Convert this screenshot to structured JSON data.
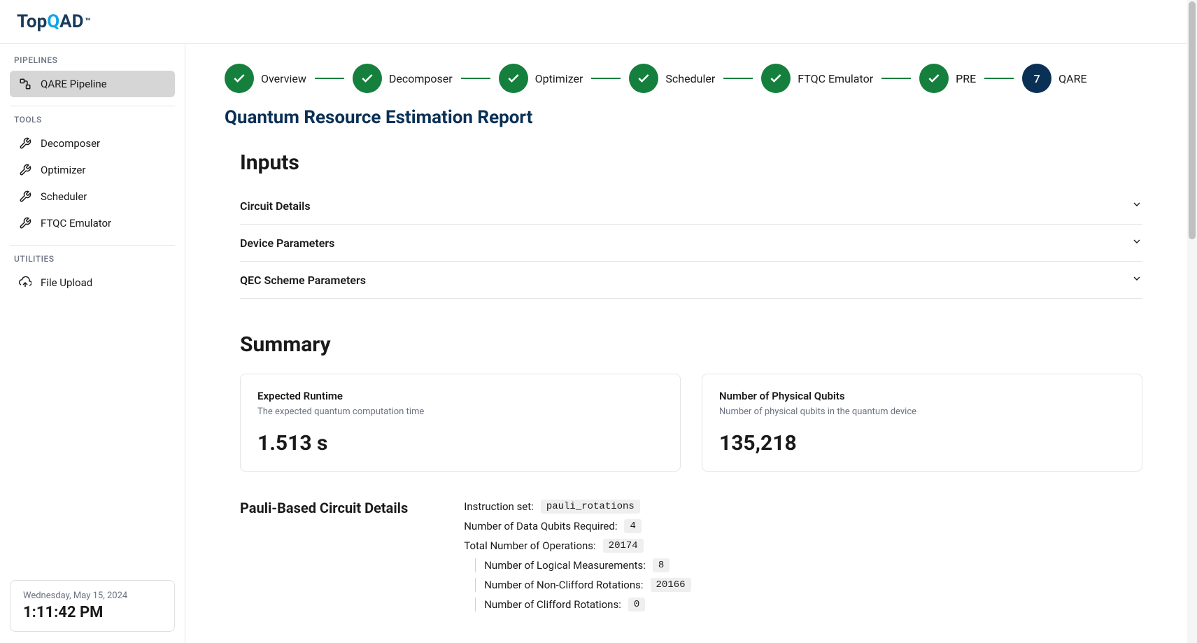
{
  "logo": {
    "part1": "Top",
    "part2": "Q",
    "part3": "AD",
    "tm": "™"
  },
  "sidebar": {
    "sections": {
      "pipelines": {
        "label": "PIPELINES",
        "items": [
          {
            "label": "QARE Pipeline"
          }
        ]
      },
      "tools": {
        "label": "TOOLS",
        "items": [
          {
            "label": "Decomposer"
          },
          {
            "label": "Optimizer"
          },
          {
            "label": "Scheduler"
          },
          {
            "label": "FTQC Emulator"
          }
        ]
      },
      "utilities": {
        "label": "UTILITIES",
        "items": [
          {
            "label": "File Upload"
          }
        ]
      }
    }
  },
  "datetime": {
    "date": "Wednesday, May 15, 2024",
    "time": "1:11:42 PM"
  },
  "stepper": [
    {
      "label": "Overview",
      "state": "done"
    },
    {
      "label": "Decomposer",
      "state": "done"
    },
    {
      "label": "Optimizer",
      "state": "done"
    },
    {
      "label": "Scheduler",
      "state": "done"
    },
    {
      "label": "FTQC Emulator",
      "state": "done"
    },
    {
      "label": "PRE",
      "state": "done"
    },
    {
      "label": "QARE",
      "state": "current",
      "num": "7"
    }
  ],
  "pageTitle": "Quantum Resource Estimation Report",
  "headings": {
    "inputs": "Inputs",
    "summary": "Summary"
  },
  "accordions": [
    {
      "label": "Circuit Details"
    },
    {
      "label": "Device Parameters"
    },
    {
      "label": "QEC Scheme Parameters"
    }
  ],
  "summaryCards": [
    {
      "title": "Expected Runtime",
      "subtitle": "The expected quantum computation time",
      "value": "1.513 s"
    },
    {
      "title": "Number of Physical Qubits",
      "subtitle": "Number of physical qubits in the quantum device",
      "value": "135,218"
    }
  ],
  "circuit": {
    "title": "Pauli-Based Circuit Details",
    "rows": [
      {
        "label": "Instruction set:",
        "value": "pauli_rotations",
        "indent": false
      },
      {
        "label": "Number of Data Qubits Required:",
        "value": "4",
        "indent": false
      },
      {
        "label": "Total Number of Operations:",
        "value": "20174",
        "indent": false
      },
      {
        "label": "Number of Logical Measurements:",
        "value": "8",
        "indent": true
      },
      {
        "label": "Number of Non-Clifford Rotations:",
        "value": "20166",
        "indent": true
      },
      {
        "label": "Number of Clifford Rotations:",
        "value": "0",
        "indent": true
      }
    ]
  }
}
